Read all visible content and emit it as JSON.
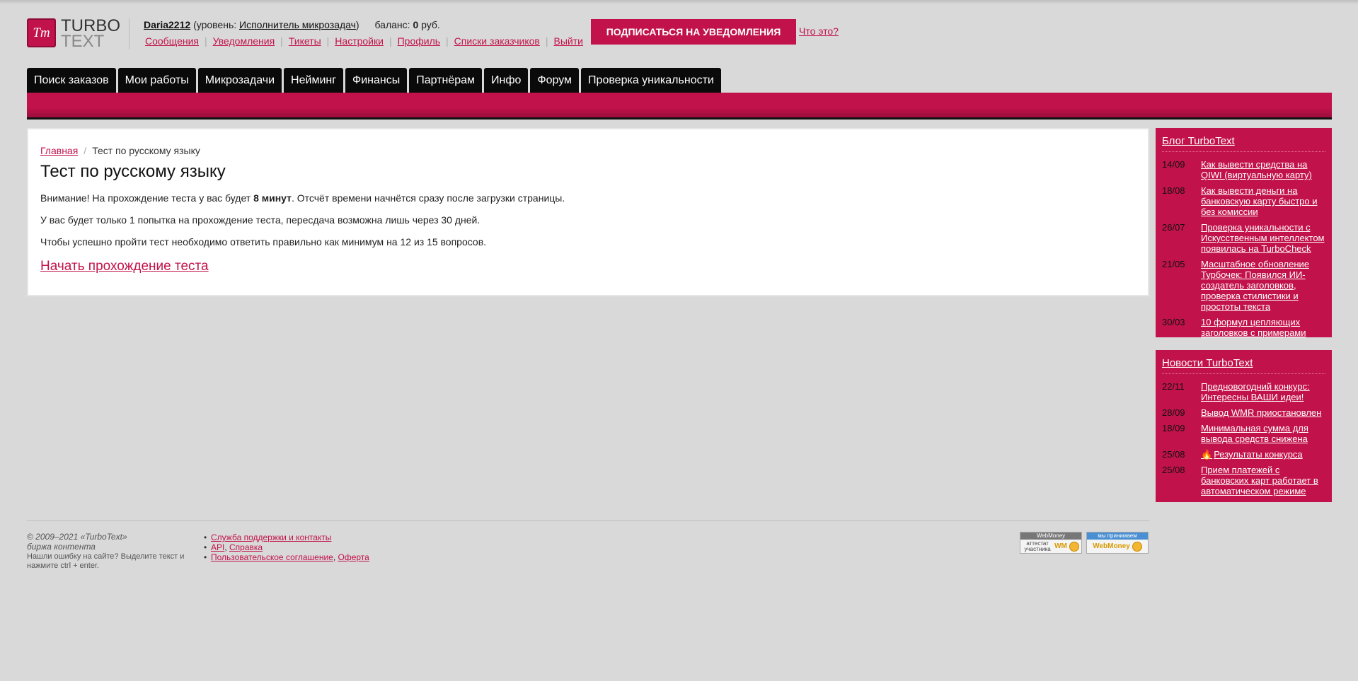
{
  "header": {
    "logo_mark": "Tт",
    "logo_line1": "TURBO",
    "logo_line2": "TEXT",
    "username": "Daria2212",
    "level_prefix": "(уровень:",
    "level": "Исполнитель микрозадач",
    "level_suffix": ")",
    "balance_prefix": "баланс:",
    "balance_value": "0",
    "balance_currency": "руб.",
    "nav": [
      "Сообщения",
      "Уведомления",
      "Тикеты",
      "Настройки",
      "Профиль",
      "Списки заказчиков",
      "Выйти"
    ],
    "subscribe_label": "Подписаться на уведомления",
    "whatis_label": "Что это?"
  },
  "tabs": [
    "Поиск заказов",
    "Мои работы",
    "Микрозадачи",
    "Нейминг",
    "Финансы",
    "Партнёрам",
    "Инфо",
    "Форум",
    "Проверка уникальности"
  ],
  "main": {
    "breadcrumb_home": "Главная",
    "breadcrumb_current": "Тест по русскому языку",
    "title": "Тест по русскому языку",
    "p1_before": "Внимание! На прохождение теста у вас будет",
    "p1_bold": "8 минут",
    "p1_after": ". Отсчёт времени начнётся сразу после загрузки страницы.",
    "p2": "У вас будет только 1 попытка на прохождение теста, пересдача возможна лишь через 30 дней.",
    "p3": "Чтобы успешно пройти тест необходимо ответить правильно как минимум на 12 из 15 вопросов.",
    "start_link": "Начать прохождение теста"
  },
  "blog": {
    "title": "Блог TurboText",
    "items": [
      {
        "date": "14/09",
        "text": "Как вывести средства на QIWI (виртуальную карту)"
      },
      {
        "date": "18/08",
        "text": "Как вывести деньги на банковскую карту быстро и без комиссии"
      },
      {
        "date": "26/07",
        "text": "Проверка уникальности с Искусственным интеллектом появилась на TurboCheck"
      },
      {
        "date": "21/05",
        "text": "Масштабное обновление Турбочек: Появился ИИ-создатель заголовков, проверка стилистики и простоты текста"
      },
      {
        "date": "30/03",
        "text": "10 формул цепляющих заголовков с примерами"
      }
    ]
  },
  "news": {
    "title": "Новости TurboText",
    "items": [
      {
        "date": "22/11",
        "text": "Предновогодний конкурс: Интересны ВАШИ идеи!"
      },
      {
        "date": "28/09",
        "text": "Вывод WMR приостановлен"
      },
      {
        "date": "18/09",
        "text": "Минимальная сумма для вывода средств снижена"
      },
      {
        "date": "25/08",
        "text": "Результаты конкурса"
      },
      {
        "date": "25/08",
        "text": "Прием платежей с банковских карт работает в автоматическом режиме"
      }
    ]
  },
  "footer": {
    "copyright": "© 2009–2021 «TurboText»",
    "tagline": "биржа контента",
    "hint": "Нашли ошибку на сайте? Выделите текст и нажмите ctrl + enter.",
    "link_support": "Служба поддержки и контакты",
    "link_api": "API",
    "link_help": "Справка",
    "link_agreement": "Пользовательское соглашение",
    "link_offer": "Оферта",
    "badge1_top": "WebMoney",
    "badge1_bottom": "аттестат участника",
    "badge1_wm": "WM",
    "badge2_top": "мы принимаем",
    "badge2_bottom": "WebMoney"
  }
}
